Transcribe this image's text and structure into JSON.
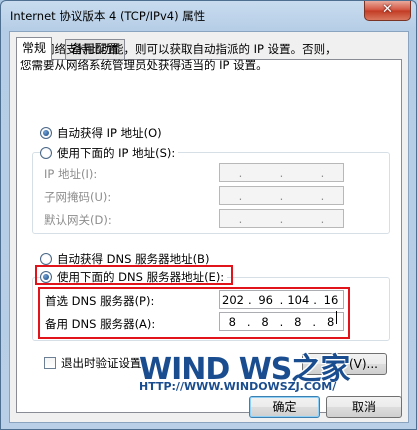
{
  "window": {
    "title": "Internet 协议版本 4 (TCP/IPv4) 属性",
    "close_glyph": "✕"
  },
  "tabs": [
    {
      "label": "常规"
    },
    {
      "label": "备用配置"
    }
  ],
  "description": [
    "如果网络支持此功能，则可以获取自动指派的 IP 设置。否则，",
    "您需要从网络系统管理员处获得适当的 IP 设置。"
  ],
  "ip_section": {
    "auto_label": "自动获得 IP 地址(O)",
    "manual_label": "使用下面的 IP 地址(S):",
    "selected": "auto",
    "fields": [
      {
        "label": "IP 地址(I):",
        "value": [
          ".",
          ".",
          "."
        ]
      },
      {
        "label": "子网掩码(U):",
        "value": [
          ".",
          ".",
          "."
        ]
      },
      {
        "label": "默认网关(D):",
        "value": [
          ".",
          ".",
          "."
        ]
      }
    ]
  },
  "dns_section": {
    "auto_label": "自动获得 DNS 服务器地址(B)",
    "manual_label": "使用下面的 DNS 服务器地址(E):",
    "selected": "manual",
    "preferred": {
      "label": "首选 DNS 服务器(P):",
      "octets": [
        "202",
        "96",
        "104",
        "16"
      ]
    },
    "alternate": {
      "label": "备用 DNS 服务器(A):",
      "octets": [
        "8",
        "8",
        "8",
        "8"
      ]
    }
  },
  "validate_on_exit_label": "退出时验证设置",
  "advanced_label": "(V)...",
  "ok_label": "确定",
  "cancel_label": "取消",
  "watermark": {
    "logo": "WIND WS之家",
    "url": "HTTP://WWW.WINDOWSZJ.COM/"
  },
  "colors": {
    "highlight": "#e0141a",
    "title_bar": "#b5cde6"
  }
}
